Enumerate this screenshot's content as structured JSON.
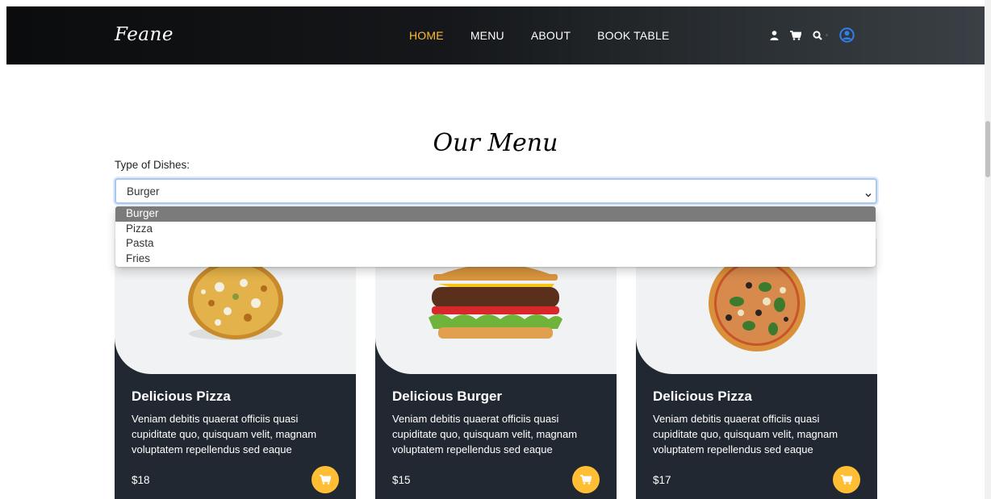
{
  "header": {
    "logo": "Feane",
    "nav": [
      {
        "label": "HOME",
        "active": true
      },
      {
        "label": "MENU",
        "active": false
      },
      {
        "label": "ABOUT",
        "active": false
      },
      {
        "label": "BOOK TABLE",
        "active": false
      }
    ],
    "icons": [
      "user-icon",
      "cart-icon",
      "search-icon",
      "account-circle-icon"
    ],
    "accent_color": "#ffbe33",
    "account_icon_color": "#2f80ed"
  },
  "menu": {
    "title": "Our Menu",
    "filter_label": "Type of Dishes:",
    "selected": "Burger",
    "options": [
      "Burger",
      "Pizza",
      "Pasta",
      "Fries"
    ]
  },
  "cards": [
    {
      "name": "Delicious Pizza",
      "description": "Veniam debitis quaerat officiis quasi cupiditate quo, quisquam velit, magnam voluptatem repellendus sed eaque",
      "price": "$18",
      "image": "pizza-image"
    },
    {
      "name": "Delicious Burger",
      "description": "Veniam debitis quaerat officiis quasi cupiditate quo, quisquam velit, magnam voluptatem repellendus sed eaque",
      "price": "$15",
      "image": "burger-image"
    },
    {
      "name": "Delicious Pizza",
      "description": "Veniam debitis quaerat officiis quasi cupiditate quo, quisquam velit, magnam voluptatem repellendus sed eaque",
      "price": "$17",
      "image": "pizza-image"
    }
  ],
  "colors": {
    "card_dark": "#222831",
    "card_light": "#f1f2f3",
    "button": "#ffbe33"
  }
}
